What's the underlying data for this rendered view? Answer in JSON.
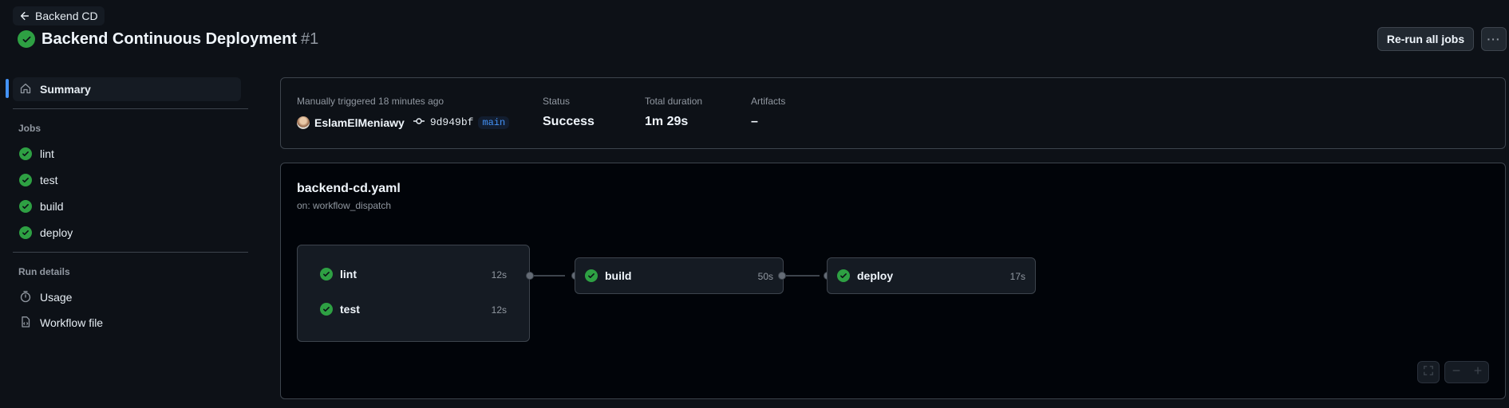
{
  "header": {
    "back_label": "Backend CD",
    "title": "Backend Continuous Deployment",
    "run_number": "#1",
    "rerun_label": "Re-run all jobs",
    "more_label": "···"
  },
  "sidebar": {
    "summary_label": "Summary",
    "jobs_heading": "Jobs",
    "jobs": [
      {
        "label": "lint"
      },
      {
        "label": "test"
      },
      {
        "label": "build"
      },
      {
        "label": "deploy"
      }
    ],
    "run_details_heading": "Run details",
    "usage_label": "Usage",
    "workflow_file_label": "Workflow file"
  },
  "summary": {
    "trigger_text": "Manually triggered 18 minutes ago",
    "actor": "EslamElMeniawy",
    "commit": "9d949bf",
    "branch": "main",
    "status_label": "Status",
    "status_value": "Success",
    "duration_label": "Total duration",
    "duration_value": "1m 29s",
    "artifacts_label": "Artifacts",
    "artifacts_value": "–"
  },
  "graph": {
    "file_name": "backend-cd.yaml",
    "trigger": "on: workflow_dispatch",
    "jobs": {
      "lint": {
        "name": "lint",
        "duration": "12s"
      },
      "test": {
        "name": "test",
        "duration": "12s"
      },
      "build": {
        "name": "build",
        "duration": "50s"
      },
      "deploy": {
        "name": "deploy",
        "duration": "17s"
      }
    }
  },
  "colors": {
    "background": "#0d1117",
    "success": "#2ea043",
    "accent": "#4493f8"
  },
  "icons": [
    "arrow-left-icon",
    "check-circle-icon",
    "home-icon",
    "stopwatch-icon",
    "file-code-icon",
    "commit-icon",
    "fullscreen-icon",
    "zoom-out-icon",
    "zoom-in-icon"
  ]
}
